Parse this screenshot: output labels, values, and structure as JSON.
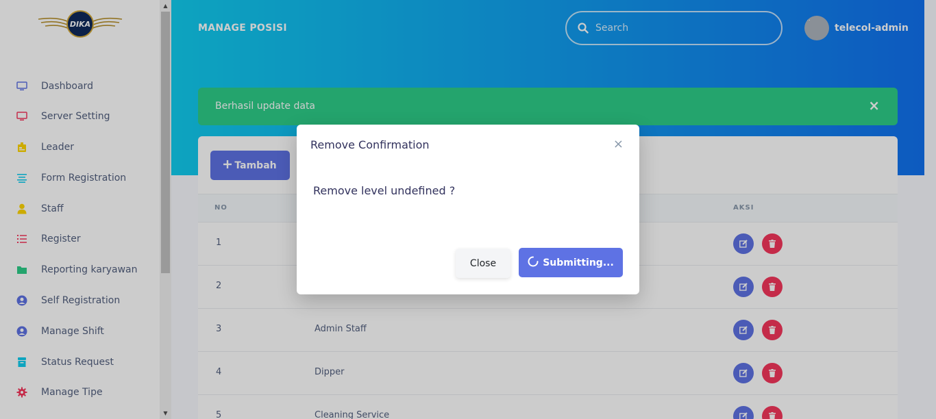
{
  "logo": {
    "text": "DIKA"
  },
  "sidebar": {
    "items": [
      {
        "label": "Dashboard",
        "icon": "monitor-icon",
        "color": "#5e72e4"
      },
      {
        "label": "Server Setting",
        "icon": "tv-icon",
        "color": "#f5365c"
      },
      {
        "label": "Leader",
        "icon": "badge-icon",
        "color": "#ffd600"
      },
      {
        "label": "Form Registration",
        "icon": "align-center-icon",
        "color": "#11cdef"
      },
      {
        "label": "Staff",
        "icon": "user-icon",
        "color": "#ffd600"
      },
      {
        "label": "Register",
        "icon": "list-icon",
        "color": "#f5365c"
      },
      {
        "label": "Reporting karyawan",
        "icon": "folder-icon",
        "color": "#2dce89"
      },
      {
        "label": "Self Registration",
        "icon": "user-circle-icon",
        "color": "#5e72e4"
      },
      {
        "label": "Manage Shift",
        "icon": "user-circle-icon",
        "color": "#5e72e4"
      },
      {
        "label": "Status Request",
        "icon": "archive-icon",
        "color": "#11cdef"
      },
      {
        "label": "Manage Tipe",
        "icon": "settings-gear-icon",
        "color": "#f5365c"
      }
    ]
  },
  "header": {
    "title": "MANAGE POSISI",
    "search_placeholder": "Search",
    "user_name": "telecol-admin",
    "avatar_alt": "..."
  },
  "alert": {
    "text": "Berhasil update data",
    "close": "×",
    "color": "#2dce89"
  },
  "card": {
    "add_button": "Tambah",
    "columns": {
      "no": "NO",
      "aksi": "AKSI"
    },
    "rows": [
      {
        "no": "1",
        "name": ""
      },
      {
        "no": "2",
        "name": ""
      },
      {
        "no": "3",
        "name": "Admin Staff"
      },
      {
        "no": "4",
        "name": "Dipper"
      },
      {
        "no": "5",
        "name": "Cleaning Service"
      }
    ]
  },
  "modal": {
    "title": "Remove Confirmation",
    "close_glyph": "×",
    "message": "Remove level undefined ?",
    "close_button": "Close",
    "submit_button": "Submitting..."
  },
  "colors": {
    "primary": "#5e72e4",
    "danger": "#f5365c",
    "success": "#2dce89",
    "header_gradient_start": "#11cdef",
    "header_gradient_end": "#1171ef"
  }
}
